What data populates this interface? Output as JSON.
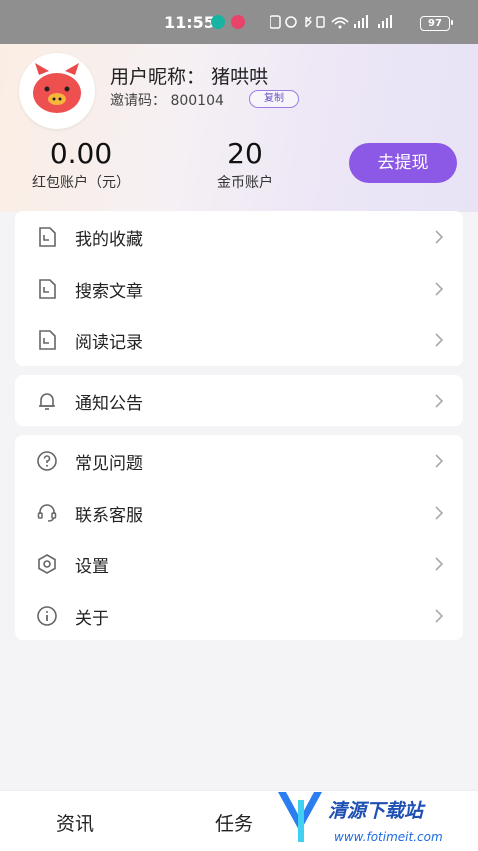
{
  "status_bar": {
    "time": "11:55",
    "battery": "97"
  },
  "profile": {
    "nickname_label": "用户昵称：",
    "nickname": "猪哄哄",
    "invite_label": "邀请码：",
    "invite_code": "800104",
    "copy_label": "复制"
  },
  "stats": {
    "redpacket": {
      "value": "0.00",
      "label": "红包账户（元）"
    },
    "coins": {
      "value": "20",
      "label": "金币账户"
    },
    "withdraw_label": "去提现"
  },
  "menu_groups": [
    {
      "items": [
        {
          "label": "我的收藏",
          "icon": "document-icon"
        },
        {
          "label": "搜索文章",
          "icon": "document-icon"
        },
        {
          "label": "阅读记录",
          "icon": "document-icon"
        }
      ]
    },
    {
      "items": [
        {
          "label": "通知公告",
          "icon": "bell-icon"
        }
      ]
    },
    {
      "items": [
        {
          "label": "常见问题",
          "icon": "question-icon"
        },
        {
          "label": "联系客服",
          "icon": "headset-icon"
        },
        {
          "label": "设置",
          "icon": "hexagon-settings-icon"
        },
        {
          "label": "关于",
          "icon": "info-icon"
        }
      ]
    }
  ],
  "tabbar": {
    "tabs": [
      {
        "label": "资讯"
      },
      {
        "label": "任务"
      }
    ]
  },
  "watermark": {
    "title": "清源下载站",
    "url": "www.fotimeit.com"
  },
  "colors": {
    "accent": "#8c59e6",
    "background": "#f4f4f6"
  }
}
